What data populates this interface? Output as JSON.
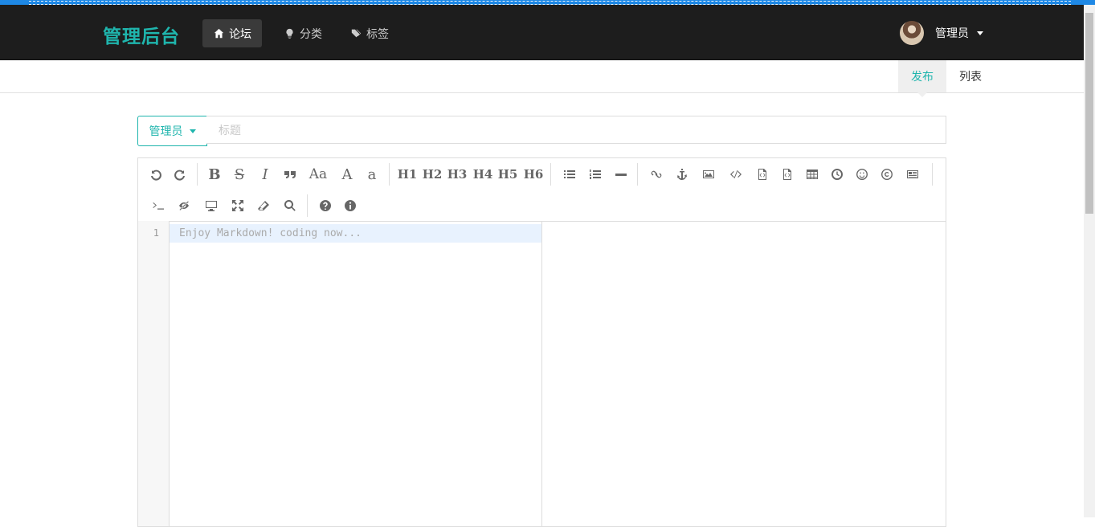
{
  "brand": "管理后台",
  "nav": [
    {
      "label": "论坛",
      "icon": "home-icon",
      "active": true
    },
    {
      "label": "分类",
      "icon": "lightbulb-icon",
      "active": false
    },
    {
      "label": "标签",
      "icon": "tags-icon",
      "active": false
    }
  ],
  "user": {
    "name": "管理员"
  },
  "subnav": [
    {
      "label": "发布",
      "active": true
    },
    {
      "label": "列表",
      "active": false
    }
  ],
  "category": {
    "selected": "管理员"
  },
  "title_input": {
    "placeholder": "标题",
    "value": ""
  },
  "toolbar": {
    "heading_labels": [
      "H1",
      "H2",
      "H3",
      "H4",
      "H5",
      "H6"
    ],
    "format_labels": {
      "bold": "B",
      "strike": "S",
      "italic": "I",
      "case": "Aa",
      "upper": "A",
      "lower": "a"
    }
  },
  "editor": {
    "line_number": "1",
    "placeholder": "Enjoy Markdown! coding now..."
  },
  "colors": {
    "accent": "#1fb5ad",
    "navbar": "#1d1d1d"
  }
}
